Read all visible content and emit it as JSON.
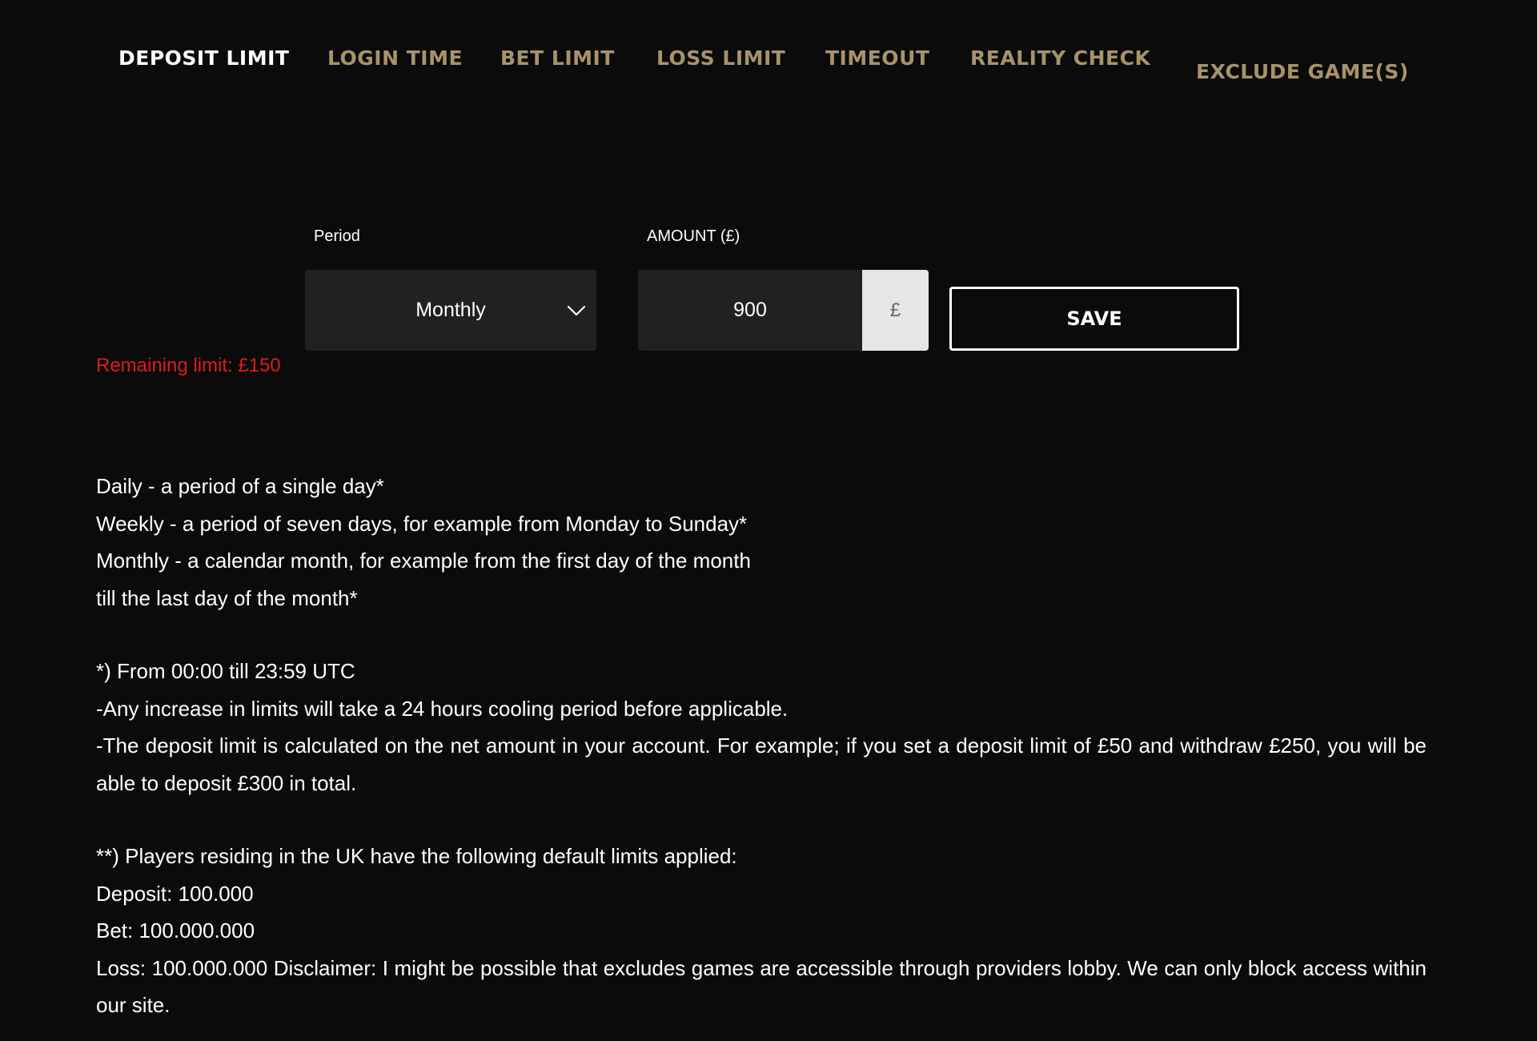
{
  "tabs": [
    {
      "label": "DEPOSIT LIMIT",
      "active": true
    },
    {
      "label": "LOGIN TIME",
      "active": false
    },
    {
      "label": "BET LIMIT",
      "active": false
    },
    {
      "label": "LOSS LIMIT",
      "active": false
    },
    {
      "label": "TIMEOUT",
      "active": false
    },
    {
      "label": "REALITY CHECK",
      "active": false
    },
    {
      "label": "EXCLUDE GAME(S)",
      "active": false
    }
  ],
  "form": {
    "period_label": "Period",
    "period_value": "Monthly",
    "amount_label": "AMOUNT (£)",
    "amount_value": "900",
    "currency_symbol": "£",
    "save_label": "SAVE",
    "remaining_text": "Remaining limit: £150"
  },
  "info": {
    "period_lines": [
      "Daily - a period of a single day*",
      "Weekly - a period of seven days, for example from Monday to Sunday*",
      "Monthly - a calendar month, for example from the first day of the month",
      "till the last day of the month*"
    ],
    "note_lines": [
      "*) From 00:00 till 23:59 UTC",
      "-Any increase in limits will take a 24 hours cooling period before applicable.",
      "-The deposit limit is calculated on the net amount in your account. For example; if you set a deposit limit of £50 and withdraw £250, you will be able to deposit £300 in total."
    ],
    "default_lines": [
      "**) Players residing in the UK have the following default limits applied:",
      "Deposit: 100.000",
      "Bet: 100.000.000",
      "Loss: 100.000.000 Disclaimer: I might be possible that excludes games are accessible through providers lobby. We can only block access within our site."
    ]
  },
  "colors": {
    "background": "#0b0b0b",
    "tab_inactive": "#a8936a",
    "tab_active": "#ffffff",
    "input_bg": "#212121",
    "warning": "#e01b1b"
  },
  "icons": {
    "select_arrow": "chevron-down-icon"
  }
}
